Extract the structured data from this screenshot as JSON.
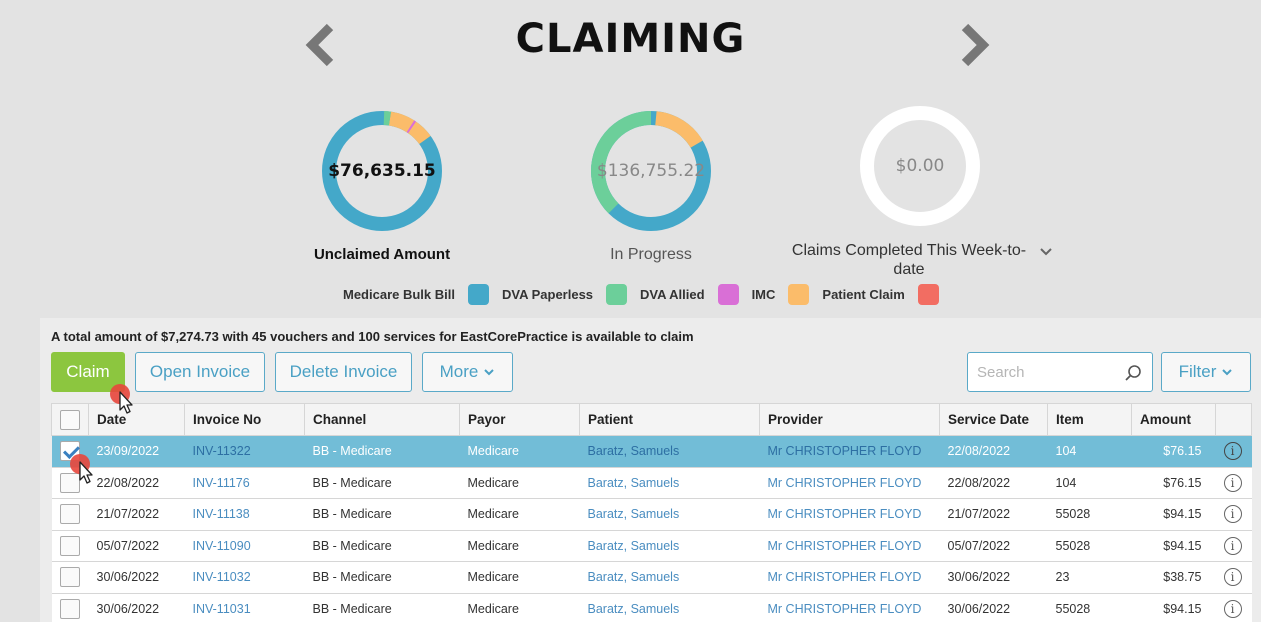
{
  "header": {
    "title": "CLAIMING"
  },
  "summary_cards": [
    {
      "value": "$76,635.15",
      "label": "Unclaimed Amount"
    },
    {
      "value": "$136,755.22",
      "label": "In Progress"
    },
    {
      "value": "$0.00",
      "label": "Claims Completed This Week-to-date"
    }
  ],
  "legend": [
    {
      "label": "Medicare Bulk Bill",
      "color": "#44a8c9"
    },
    {
      "label": "DVA Paperless",
      "color": "#6ccf9a"
    },
    {
      "label": "DVA Allied",
      "color": "#d96fd6"
    },
    {
      "label": "IMC",
      "color": "#fbbc6a"
    },
    {
      "label": "Patient Claim",
      "color": "#f26d62"
    }
  ],
  "summary_text": "A total amount of $7,274.73 with 45 vouchers and 100 services for EastCorePractice is available to claim",
  "toolbar": {
    "claim": "Claim",
    "open_invoice": "Open Invoice",
    "delete_invoice": "Delete Invoice",
    "more": "More",
    "search_placeholder": "Search",
    "filter": "Filter"
  },
  "table": {
    "columns": [
      "Date",
      "Invoice No",
      "Channel",
      "Payor",
      "Patient",
      "Provider",
      "Service Date",
      "Item",
      "Amount"
    ],
    "rows": [
      {
        "date": "23/09/2022",
        "invoice": "INV-11322",
        "channel": "BB - Medicare",
        "payor": "Medicare",
        "patient": "Baratz, Samuels",
        "provider": "Mr CHRISTOPHER FLOYD",
        "service_date": "22/08/2022",
        "item": "104",
        "amount": "$76.15"
      },
      {
        "date": "22/08/2022",
        "invoice": "INV-11176",
        "channel": "BB - Medicare",
        "payor": "Medicare",
        "patient": "Baratz, Samuels",
        "provider": "Mr CHRISTOPHER FLOYD",
        "service_date": "22/08/2022",
        "item": "104",
        "amount": "$76.15"
      },
      {
        "date": "21/07/2022",
        "invoice": "INV-11138",
        "channel": "BB - Medicare",
        "payor": "Medicare",
        "patient": "Baratz, Samuels",
        "provider": "Mr CHRISTOPHER FLOYD",
        "service_date": "21/07/2022",
        "item": "55028",
        "amount": "$94.15"
      },
      {
        "date": "05/07/2022",
        "invoice": "INV-11090",
        "channel": "BB - Medicare",
        "payor": "Medicare",
        "patient": "Baratz, Samuels",
        "provider": "Mr CHRISTOPHER FLOYD",
        "service_date": "05/07/2022",
        "item": "55028",
        "amount": "$94.15"
      },
      {
        "date": "30/06/2022",
        "invoice": "INV-11032",
        "channel": "BB - Medicare",
        "payor": "Medicare",
        "patient": "Baratz, Samuels",
        "provider": "Mr CHRISTOPHER FLOYD",
        "service_date": "30/06/2022",
        "item": "23",
        "amount": "$38.75"
      },
      {
        "date": "30/06/2022",
        "invoice": "INV-11031",
        "channel": "BB - Medicare",
        "payor": "Medicare",
        "patient": "Baratz, Samuels",
        "provider": "Mr CHRISTOPHER FLOYD",
        "service_date": "30/06/2022",
        "item": "55028",
        "amount": "$94.15"
      }
    ]
  }
}
